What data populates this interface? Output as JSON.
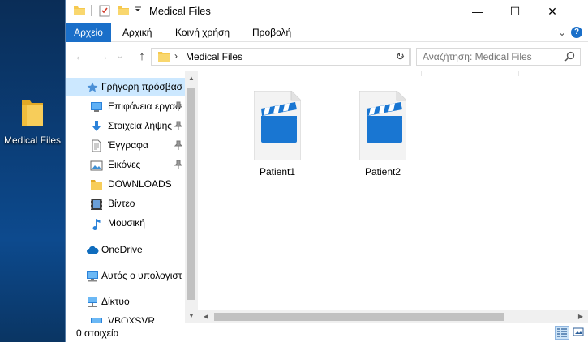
{
  "desktop": {
    "icon_label": "Medical Files"
  },
  "window": {
    "title": "Medical Files",
    "controls": {
      "minimize": "—",
      "maximize": "☐",
      "close": "✕"
    }
  },
  "menu": {
    "items": [
      "Αρχείο",
      "Αρχική",
      "Κοινή χρήση",
      "Προβολή"
    ],
    "expand": "⌄",
    "help": "?"
  },
  "address": {
    "back": "←",
    "forward": "→",
    "recent": "⌄",
    "up": "↑",
    "chevron": "›",
    "path": "Medical Files",
    "dropdown": "⌄",
    "refresh": "↻",
    "search_placeholder": "Αναζήτηση: Medical Files"
  },
  "nav": {
    "quick_access": "Γρήγορη πρόσβαση",
    "items": [
      {
        "label": "Επιφάνεια εργασίας",
        "pinned": true
      },
      {
        "label": "Στοιχεία λήψης",
        "pinned": true
      },
      {
        "label": "Έγγραφα",
        "pinned": true
      },
      {
        "label": "Εικόνες",
        "pinned": true
      },
      {
        "label": "DOWNLOADS",
        "pinned": false
      },
      {
        "label": "Βίντεο",
        "pinned": false
      },
      {
        "label": "Μουσική",
        "pinned": false
      }
    ],
    "onedrive": "OneDrive",
    "this_pc": "Αυτός ο υπολογιστής",
    "network": "Δίκτυο",
    "network_child": "VBOXSVR"
  },
  "files": [
    {
      "name": "Patient1",
      "type": "video"
    },
    {
      "name": "Patient2",
      "type": "video"
    }
  ],
  "status": {
    "count": "0 στοιχεία"
  },
  "colors": {
    "accent": "#1a6fc9",
    "selected": "#cce8ff",
    "folder": "#f6c94f",
    "video_icon": "#1976d2"
  }
}
